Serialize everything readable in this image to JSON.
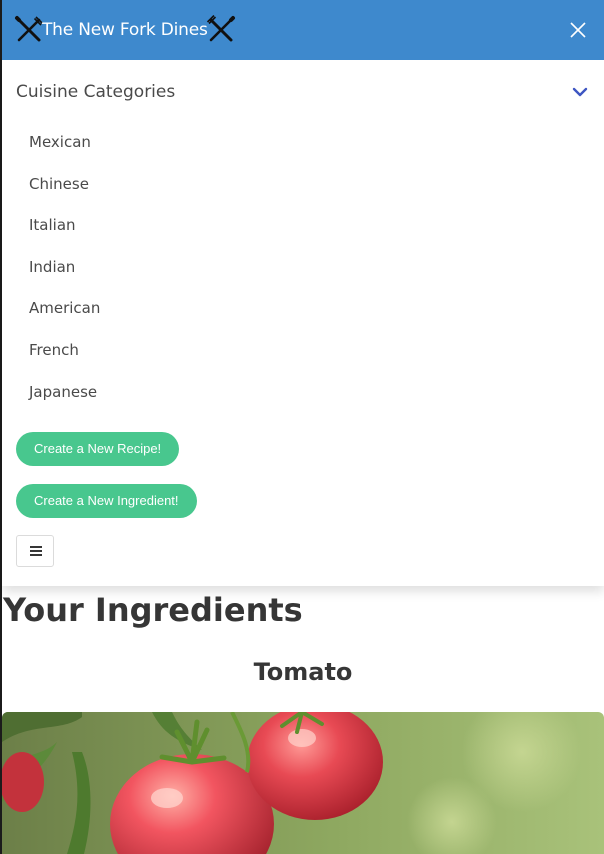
{
  "header": {
    "brand_text": "The New Fork Dines",
    "brand_icon": "fork-knife-crossed-icon",
    "close_icon": "close-icon",
    "color": "#3e89cd"
  },
  "dropdown": {
    "title": "Cuisine Categories",
    "chevron_icon": "chevron-down-icon",
    "items": [
      "Mexican",
      "Chinese",
      "Italian",
      "Indian",
      "American",
      "French",
      "Japanese"
    ],
    "create_recipe_label": "Create a New Recipe!",
    "create_ingredient_label": "Create a New Ingredient!",
    "menu_icon": "hamburger-menu-icon",
    "accent_color": "#48c78e"
  },
  "main": {
    "page_title": "Your Ingredients",
    "ingredient": {
      "name": "Tomato"
    }
  }
}
